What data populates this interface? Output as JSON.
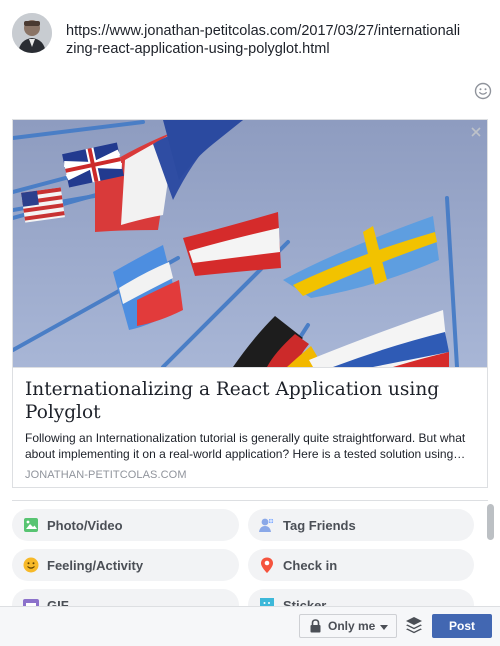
{
  "composer": {
    "status_text": "https://www.jonathan-petitcolas.com/2017/03/27/internationalizing-react-application-using-polyglot.html"
  },
  "link_preview": {
    "title": "Internationalizing a React Application using Polyglot",
    "description": "Following an Internationalization tutorial is generally quite straightforward. But what about implementing it on a real-world application? Here is a tested solution using…",
    "domain": "JONATHAN-PETITCOLAS.COM"
  },
  "options": [
    {
      "label": "Photo/Video",
      "icon": "photo-video-icon",
      "color": "#58c472"
    },
    {
      "label": "Tag Friends",
      "icon": "tag-friends-icon",
      "color": "#5890ff"
    },
    {
      "label": "Feeling/Activity",
      "icon": "feeling-activity-icon",
      "color": "#f7b928"
    },
    {
      "label": "Check in",
      "icon": "check-in-icon",
      "color": "#f5533d"
    },
    {
      "label": "GIF",
      "icon": "gif-icon",
      "color": "#8c72cb"
    },
    {
      "label": "Sticker",
      "icon": "sticker-icon",
      "color": "#3db8d9"
    }
  ],
  "footer": {
    "privacy_label": "Only me",
    "post_label": "Post"
  },
  "colors": {
    "accent": "#4267b2",
    "pill_bg": "#f2f3f5",
    "footer_bg": "#f6f7f9"
  }
}
